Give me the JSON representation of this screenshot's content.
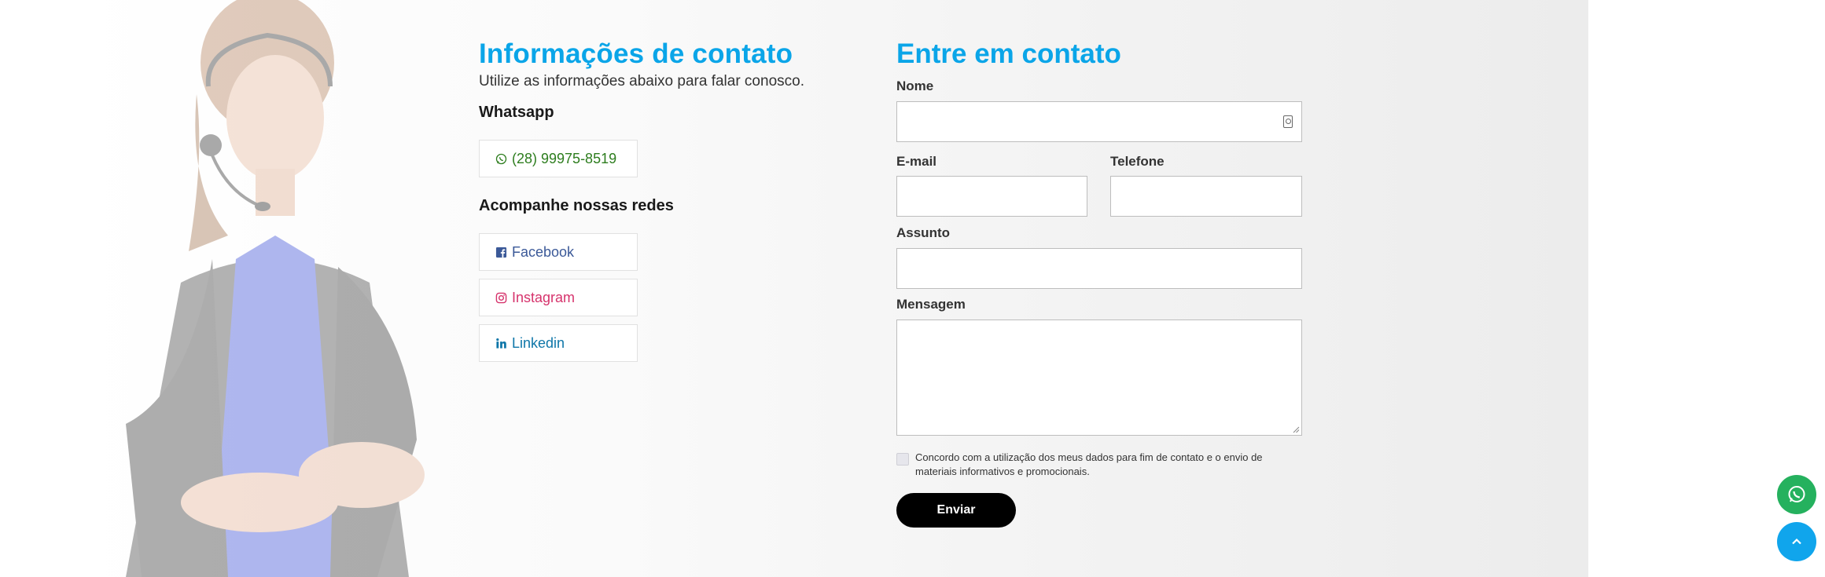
{
  "contact_info": {
    "title": "Informações de contato",
    "subtitle": "Utilize as informações abaixo para falar conosco.",
    "whatsapp_label": "Whatsapp",
    "whatsapp_number": "(28) 99975-8519",
    "social_label": "Acompanhe nossas redes",
    "social": [
      {
        "label": "Facebook",
        "icon": "facebook-icon",
        "color": "#3b5998"
      },
      {
        "label": "Instagram",
        "icon": "instagram-icon",
        "color": "#d6336c"
      },
      {
        "label": "Linkedin",
        "icon": "linkedin-icon",
        "color": "#0e76a8"
      }
    ]
  },
  "form": {
    "title": "Entre em contato",
    "name_label": "Nome",
    "name_value": "",
    "email_label": "E-mail",
    "email_value": "",
    "phone_label": "Telefone",
    "phone_value": "",
    "subject_label": "Assunto",
    "subject_value": "",
    "message_label": "Mensagem",
    "message_value": "",
    "consent_text": "Concordo com a utilização dos meus dados para fim de contato e o envio de materiais informativos e promocionais.",
    "consent_checked": false,
    "submit_label": "Enviar"
  },
  "floating": {
    "whatsapp_icon": "whatsapp-icon",
    "top_icon": "chevron-up-icon"
  },
  "colors": {
    "accent": "#0aa5e8",
    "whatsapp_green": "#25b15e",
    "scroll_top_blue": "#10a5ec",
    "submit_bg": "#000000"
  }
}
